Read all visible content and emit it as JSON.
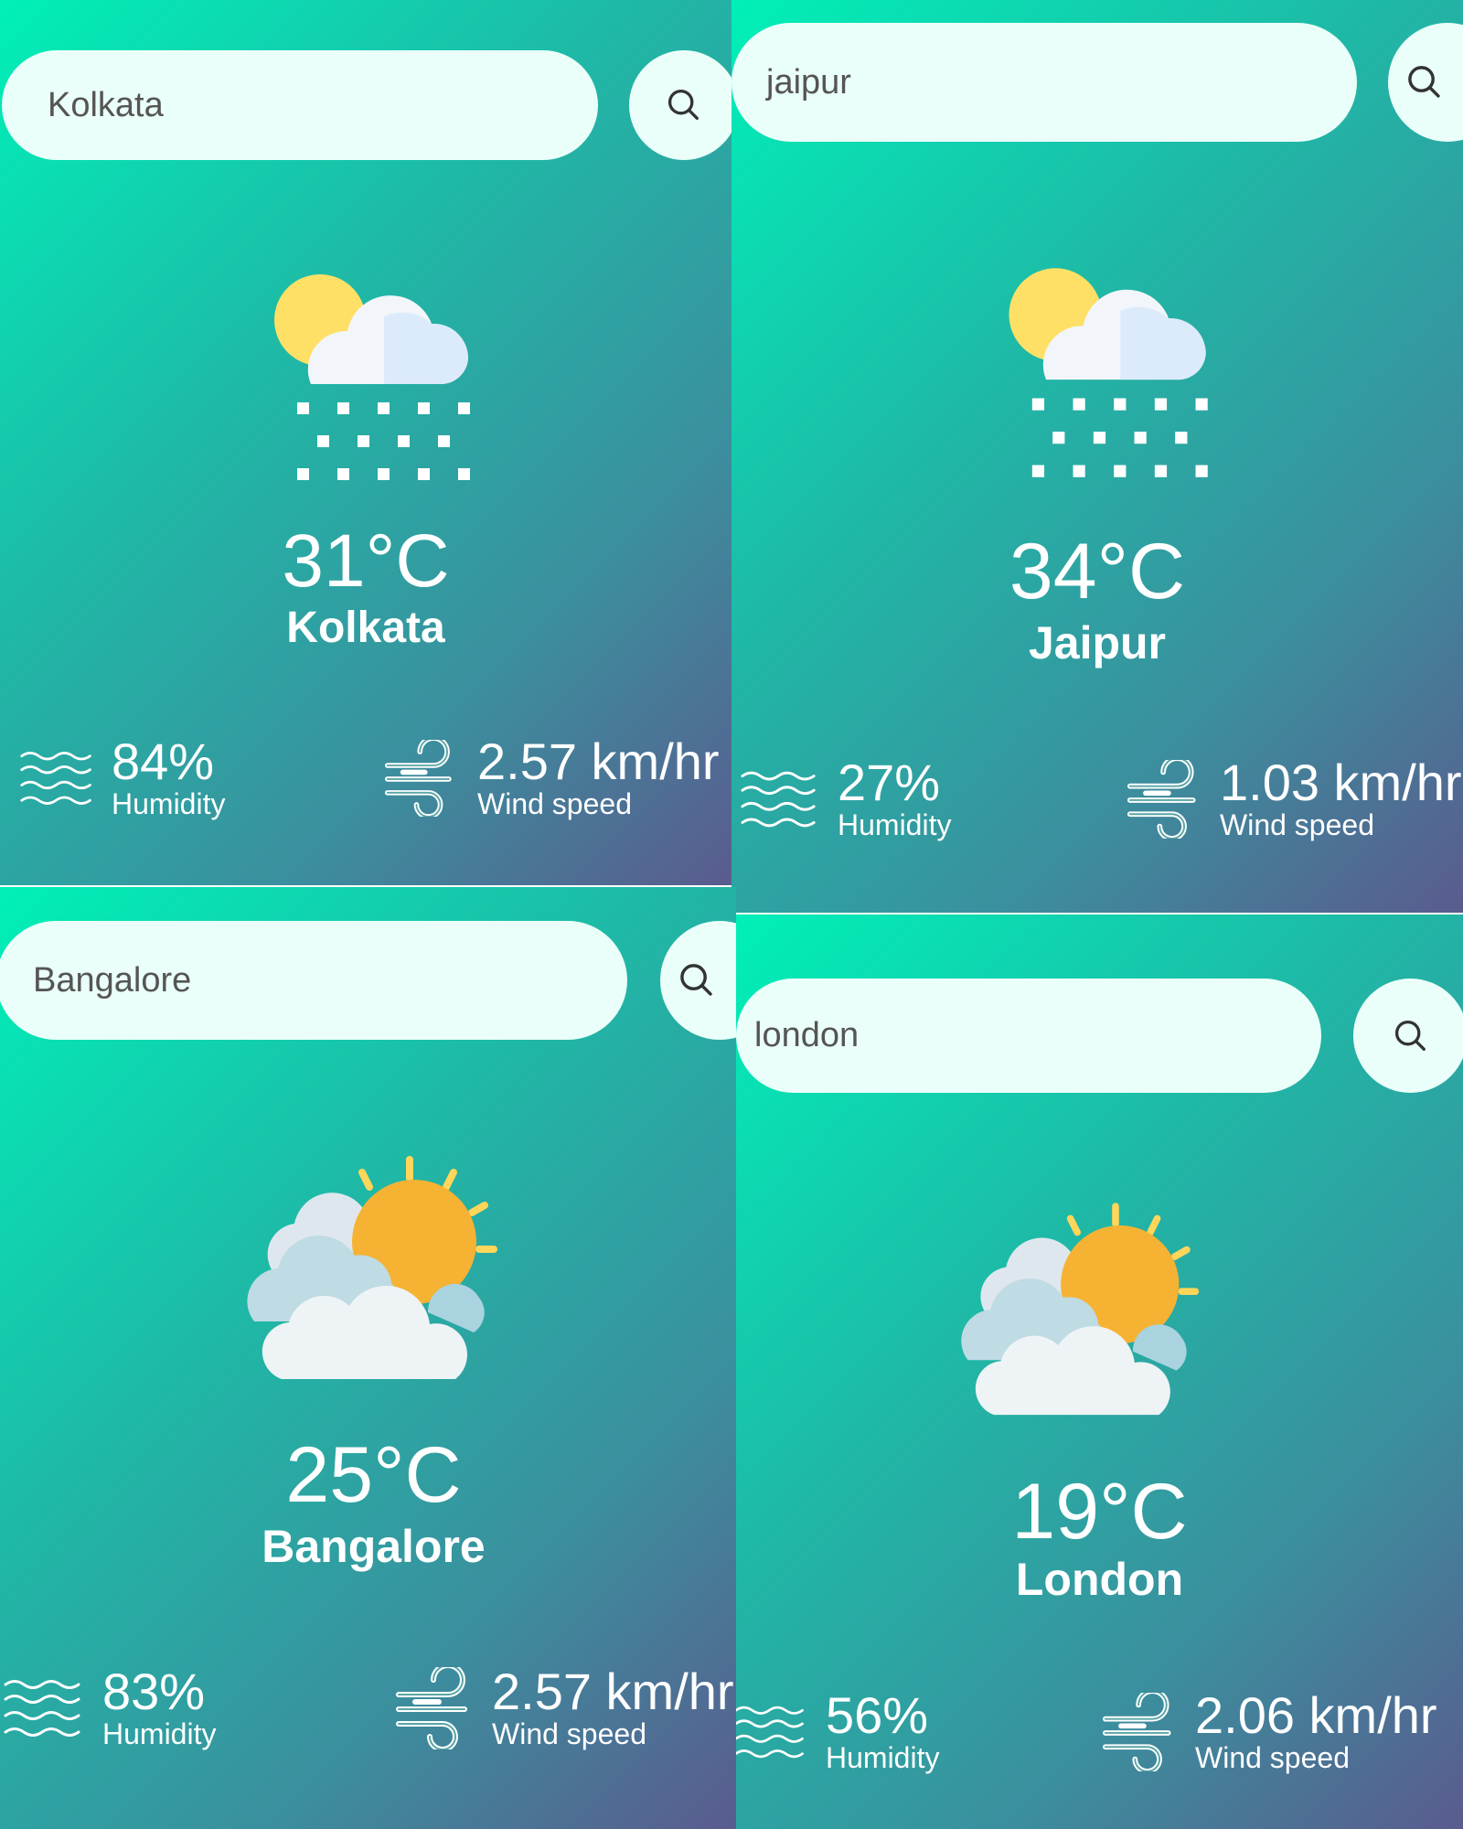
{
  "panels": [
    {
      "search": {
        "value": "Kolkata"
      },
      "condition_icon": "snow-cloud-sun-icon",
      "temperature": "31°C",
      "city": "Kolkata",
      "humidity": {
        "value": "84%",
        "label": "Humidity"
      },
      "wind": {
        "value": "2.57 km/hr",
        "label": "Wind speed"
      }
    },
    {
      "search": {
        "value": "jaipur"
      },
      "condition_icon": "snow-cloud-sun-icon",
      "temperature": "34°C",
      "city": "Jaipur",
      "humidity": {
        "value": "27%",
        "label": "Humidity"
      },
      "wind": {
        "value": "1.03 km/hr",
        "label": "Wind speed"
      }
    },
    {
      "search": {
        "value": "Bangalore"
      },
      "condition_icon": "partly-cloudy-sun-icon",
      "temperature": "25°C",
      "city": "Bangalore",
      "humidity": {
        "value": "83%",
        "label": "Humidity"
      },
      "wind": {
        "value": "2.57 km/hr",
        "label": "Wind speed"
      }
    },
    {
      "search": {
        "value": "london"
      },
      "condition_icon": "partly-cloudy-sun-icon",
      "temperature": "19°C",
      "city": "London",
      "humidity": {
        "value": "56%",
        "label": "Humidity"
      },
      "wind": {
        "value": "2.06 km/hr",
        "label": "Wind speed"
      }
    }
  ],
  "colors": {
    "gradient_start": "#00f0b8",
    "gradient_end": "#5a5b8e",
    "search_background": "#eafff9",
    "sun": "#ffdf6b",
    "sun_orange": "#f7a21b"
  }
}
